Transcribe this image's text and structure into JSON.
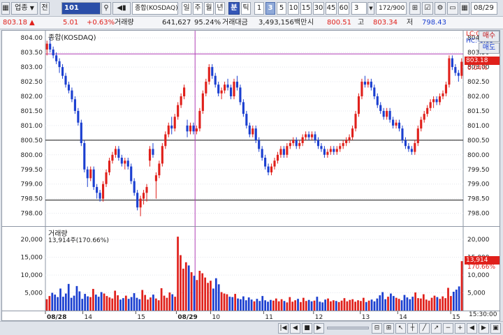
{
  "toolbar": {
    "market_select": "업종",
    "jeon_label": "전",
    "code_value": "101",
    "index_name": "종합(KOSDAQ)",
    "period_tabs": [
      "일",
      "주",
      "월",
      "년",
      "분",
      "틱"
    ],
    "active_period": "분",
    "interval_buttons": [
      "1",
      "3",
      "5",
      "10",
      "15",
      "30",
      "45",
      "60"
    ],
    "active_interval": "3",
    "interval_input": "3",
    "count_display": "172/900",
    "date_value": "08/29"
  },
  "infobar": {
    "current_price": "803.18",
    "change_arrow": "▲",
    "change_value": "5.01",
    "change_pct": "+0.63%",
    "volume_label": "거래량",
    "volume_value": "641,627",
    "volume_ratio": "95.24%",
    "amount_label": "거래대금",
    "amount_value": "3,493,156백만",
    "open_label": "시",
    "open_value": "800.51",
    "high_label": "고",
    "high_value": "803.34",
    "low_label": "저",
    "low_value": "798.43"
  },
  "price_chart": {
    "title": "종합(KOSDAQ)",
    "lc_label": "LC:0.67",
    "hc_label": "HC:-0.09",
    "current_tag": "803.18",
    "current_pct_tag": "0.04%",
    "buy_button": "매수",
    "sell_button": "매도"
  },
  "volume_chart": {
    "title": "거래량",
    "last_value_label": "13,914주(170.66%)",
    "current_tag": "13,914",
    "current_pct_tag": "170.66%"
  },
  "x_axis": {
    "time_label": "15:30:00"
  },
  "colors": {
    "up": "#e0201b",
    "down": "#1b3fd0",
    "accent": "#3557b7"
  },
  "chart_data": [
    {
      "type": "candlestick",
      "title": "종합(KOSDAQ)",
      "ylim": [
        797.8,
        804.1
      ],
      "y_ticks": [
        "804.00",
        "803.50",
        "803.00",
        "802.50",
        "802.00",
        "801.50",
        "801.00",
        "800.50",
        "800.00",
        "799.50",
        "799.00",
        "798.50",
        "798.00"
      ],
      "x_ticks": [
        "08/28",
        "14",
        "15",
        "08/29",
        "10",
        "11",
        "12",
        "13",
        "14",
        "15"
      ],
      "ohlc": [
        [
          803.6,
          803.9,
          803.4,
          803.8
        ],
        [
          803.8,
          804.0,
          803.5,
          803.6
        ],
        [
          803.6,
          803.7,
          803.3,
          803.4
        ],
        [
          803.4,
          803.5,
          803.1,
          803.2
        ],
        [
          803.2,
          803.3,
          802.8,
          803.0
        ],
        [
          803.0,
          803.1,
          802.6,
          802.7
        ],
        [
          802.7,
          802.8,
          802.3,
          802.4
        ],
        [
          802.4,
          802.5,
          802.1,
          802.2
        ],
        [
          802.2,
          802.3,
          801.8,
          801.9
        ],
        [
          801.9,
          802.0,
          801.4,
          801.5
        ],
        [
          801.5,
          801.6,
          801.0,
          801.1
        ],
        [
          801.1,
          801.2,
          800.3,
          800.4
        ],
        [
          800.4,
          800.5,
          799.4,
          799.5
        ],
        [
          799.5,
          799.6,
          798.9,
          799.2
        ],
        [
          799.2,
          799.6,
          799.1,
          799.5
        ],
        [
          799.5,
          799.6,
          798.8,
          798.9
        ],
        [
          798.9,
          799.0,
          798.5,
          798.7
        ],
        [
          798.7,
          798.8,
          798.4,
          798.5
        ],
        [
          798.5,
          799.1,
          798.4,
          799.0
        ],
        [
          799.0,
          799.5,
          798.9,
          799.4
        ],
        [
          799.4,
          799.9,
          799.3,
          799.8
        ],
        [
          799.8,
          800.1,
          799.7,
          800.0
        ],
        [
          800.0,
          800.3,
          799.9,
          800.2
        ],
        [
          800.2,
          800.3,
          799.8,
          799.9
        ],
        [
          799.9,
          800.0,
          799.6,
          799.7
        ],
        [
          799.7,
          799.9,
          799.5,
          799.8
        ],
        [
          799.8,
          799.9,
          799.5,
          799.6
        ],
        [
          799.6,
          799.7,
          799.0,
          799.1
        ],
        [
          799.1,
          799.2,
          798.6,
          798.7
        ],
        [
          798.7,
          798.8,
          798.1,
          798.2
        ],
        [
          798.2,
          798.6,
          797.9,
          798.5
        ],
        [
          798.5,
          798.8,
          798.3,
          798.7
        ],
        [
          798.7,
          799.0,
          798.4,
          798.9
        ],
        [
          799.8,
          800.3,
          799.6,
          800.2
        ],
        [
          800.2,
          800.4,
          799.9,
          800.0
        ],
        [
          799.1,
          799.4,
          798.5,
          799.3
        ],
        [
          799.3,
          799.8,
          799.2,
          799.7
        ],
        [
          799.7,
          800.4,
          799.6,
          800.3
        ],
        [
          800.3,
          800.8,
          800.2,
          800.7
        ],
        [
          800.7,
          801.1,
          800.6,
          801.0
        ],
        [
          801.0,
          801.3,
          800.7,
          800.9
        ],
        [
          800.9,
          801.4,
          800.8,
          801.3
        ],
        [
          801.3,
          801.8,
          801.2,
          801.7
        ],
        [
          801.7,
          802.1,
          801.6,
          802.0
        ],
        [
          802.0,
          802.4,
          801.9,
          802.3
        ],
        [
          801.0,
          801.2,
          800.6,
          800.8
        ],
        [
          800.8,
          801.1,
          800.7,
          801.0
        ],
        [
          801.0,
          801.1,
          800.7,
          800.8
        ],
        [
          800.8,
          801.0,
          800.7,
          800.9
        ],
        [
          800.9,
          801.6,
          800.8,
          801.5
        ],
        [
          801.5,
          802.2,
          801.4,
          802.1
        ],
        [
          802.1,
          802.6,
          802.0,
          802.5
        ],
        [
          802.5,
          803.1,
          802.4,
          803.0
        ],
        [
          803.0,
          803.1,
          802.6,
          802.7
        ],
        [
          802.7,
          802.8,
          802.3,
          802.4
        ],
        [
          802.4,
          802.5,
          802.0,
          802.1
        ],
        [
          802.1,
          802.3,
          801.9,
          802.2
        ],
        [
          802.2,
          802.5,
          802.1,
          802.4
        ],
        [
          802.4,
          802.6,
          802.2,
          802.3
        ],
        [
          802.3,
          802.4,
          801.9,
          802.0
        ],
        [
          802.0,
          802.6,
          801.9,
          802.5
        ],
        [
          802.5,
          802.7,
          802.2,
          802.3
        ],
        [
          802.3,
          802.4,
          801.7,
          801.8
        ],
        [
          801.8,
          801.9,
          801.3,
          801.4
        ],
        [
          801.4,
          801.5,
          800.9,
          801.0
        ],
        [
          801.0,
          801.1,
          800.6,
          800.7
        ],
        [
          800.7,
          801.0,
          800.6,
          800.9
        ],
        [
          800.9,
          801.0,
          800.4,
          800.5
        ],
        [
          800.5,
          800.6,
          800.1,
          800.2
        ],
        [
          800.2,
          800.3,
          799.8,
          799.9
        ],
        [
          799.9,
          800.0,
          799.5,
          799.6
        ],
        [
          799.6,
          799.7,
          799.3,
          799.4
        ],
        [
          799.4,
          799.7,
          799.3,
          799.6
        ],
        [
          799.6,
          799.9,
          799.5,
          799.8
        ],
        [
          799.8,
          800.1,
          799.7,
          800.0
        ],
        [
          800.0,
          800.3,
          799.9,
          800.2
        ],
        [
          800.2,
          800.3,
          799.9,
          800.0
        ],
        [
          800.0,
          800.4,
          799.9,
          800.3
        ],
        [
          800.3,
          800.5,
          800.2,
          800.4
        ],
        [
          800.4,
          800.6,
          800.3,
          800.5
        ],
        [
          800.5,
          800.6,
          800.2,
          800.3
        ],
        [
          800.3,
          800.5,
          800.2,
          800.4
        ],
        [
          800.4,
          800.7,
          800.3,
          800.6
        ],
        [
          800.6,
          800.8,
          800.5,
          800.7
        ],
        [
          800.7,
          800.8,
          800.5,
          800.6
        ],
        [
          800.6,
          800.8,
          800.5,
          800.7
        ],
        [
          800.7,
          800.8,
          800.4,
          800.5
        ],
        [
          800.5,
          800.6,
          800.2,
          800.3
        ],
        [
          800.3,
          800.4,
          800.1,
          800.2
        ],
        [
          800.2,
          800.3,
          799.9,
          800.0
        ],
        [
          800.0,
          800.2,
          799.9,
          800.1
        ],
        [
          800.1,
          800.3,
          800.0,
          800.2
        ],
        [
          800.2,
          800.3,
          800.0,
          800.1
        ],
        [
          800.1,
          800.3,
          800.0,
          800.2
        ],
        [
          800.2,
          800.4,
          800.1,
          800.3
        ],
        [
          800.3,
          800.5,
          800.2,
          800.4
        ],
        [
          800.4,
          800.6,
          800.3,
          800.5
        ],
        [
          800.5,
          800.7,
          800.4,
          800.6
        ],
        [
          800.6,
          801.0,
          800.5,
          800.9
        ],
        [
          800.9,
          801.5,
          800.8,
          801.4
        ],
        [
          801.4,
          802.1,
          801.3,
          802.0
        ],
        [
          802.0,
          802.6,
          801.9,
          802.5
        ],
        [
          802.5,
          802.7,
          802.3,
          802.4
        ],
        [
          802.4,
          802.6,
          802.3,
          802.5
        ],
        [
          802.5,
          802.6,
          802.2,
          802.3
        ],
        [
          802.3,
          802.4,
          801.9,
          802.0
        ],
        [
          802.0,
          802.1,
          801.6,
          801.7
        ],
        [
          801.7,
          801.8,
          801.4,
          801.5
        ],
        [
          801.5,
          801.6,
          801.2,
          801.3
        ],
        [
          801.3,
          801.6,
          801.2,
          801.5
        ],
        [
          801.5,
          801.6,
          801.1,
          801.2
        ],
        [
          801.2,
          801.3,
          800.9,
          801.0
        ],
        [
          801.0,
          801.2,
          800.9,
          801.1
        ],
        [
          801.1,
          801.2,
          800.8,
          800.9
        ],
        [
          800.9,
          801.0,
          800.4,
          800.5
        ],
        [
          800.5,
          800.6,
          800.2,
          800.3
        ],
        [
          800.3,
          800.4,
          800.1,
          800.2
        ],
        [
          800.2,
          800.3,
          800.0,
          800.1
        ],
        [
          800.1,
          800.5,
          800.0,
          800.4
        ],
        [
          800.4,
          801.0,
          800.3,
          800.9
        ],
        [
          800.9,
          801.3,
          800.8,
          801.2
        ],
        [
          801.2,
          801.5,
          801.1,
          801.4
        ],
        [
          801.4,
          801.7,
          801.3,
          801.6
        ],
        [
          801.6,
          801.9,
          801.5,
          801.8
        ],
        [
          801.8,
          802.0,
          801.6,
          801.9
        ],
        [
          801.9,
          802.0,
          801.7,
          801.8
        ],
        [
          801.8,
          802.1,
          801.7,
          802.0
        ],
        [
          802.0,
          802.2,
          801.9,
          802.1
        ],
        [
          802.1,
          802.5,
          802.0,
          802.4
        ],
        [
          802.4,
          803.4,
          802.3,
          803.3
        ],
        [
          803.3,
          803.4,
          802.9,
          803.0
        ],
        [
          803.0,
          803.1,
          802.7,
          802.8
        ],
        [
          802.8,
          802.9,
          802.5,
          802.7
        ],
        [
          802.7,
          803.3,
          802.6,
          803.18
        ]
      ],
      "hlines": [
        803.45,
        800.5,
        798.45
      ]
    },
    {
      "type": "bar",
      "title": "거래량",
      "ylim": [
        0,
        22000
      ],
      "y_ticks": [
        "20,000",
        "15,000",
        "10,000",
        "5,000"
      ],
      "values": [
        3200,
        4100,
        5000,
        4500,
        3800,
        6200,
        3900,
        4800,
        7500,
        3600,
        4200,
        6900,
        5400,
        3300,
        4700,
        4000,
        3800,
        6100,
        4500,
        3900,
        5200,
        4800,
        4100,
        3700,
        3400,
        5600,
        4300,
        3100,
        3500,
        4200,
        3300,
        3800,
        4900,
        3600,
        3200,
        5800,
        4400,
        3100,
        3700,
        4500,
        3400,
        2900,
        6300,
        4200,
        3600,
        5100,
        4600,
        3900,
        20800,
        15600,
        11800,
        13600,
        12700,
        10800,
        9800,
        8600,
        11200,
        10500,
        9300,
        7800,
        8400,
        6200,
        9100,
        7400,
        5200,
        4800,
        4600,
        3900,
        3800,
        4700,
        3400,
        3200,
        4000,
        2900,
        3700,
        3100,
        2600,
        3300,
        2700,
        4100,
        2900,
        2500,
        3000,
        2800,
        3400,
        2600,
        3200,
        2700,
        2300,
        3800,
        2500,
        2900,
        3300,
        2400,
        3600,
        2700,
        3000,
        2600,
        2800,
        3900,
        2500,
        2300,
        3100,
        3400,
        2600,
        2900,
        2700,
        2400,
        2800,
        3500,
        2600,
        3000,
        3200,
        2500,
        2900,
        2700,
        3600,
        2400,
        2800,
        3100,
        2600,
        3400,
        4300,
        5200,
        3200,
        3900,
        4800,
        4100,
        3600,
        3300,
        2900,
        4400,
        3700,
        3200,
        3900,
        5100,
        3500,
        3400,
        4600,
        3100,
        2800,
        3600,
        4200,
        3800,
        3300,
        4000,
        3500,
        6400,
        4100,
        5300,
        5900,
        6800,
        13914
      ]
    }
  ]
}
